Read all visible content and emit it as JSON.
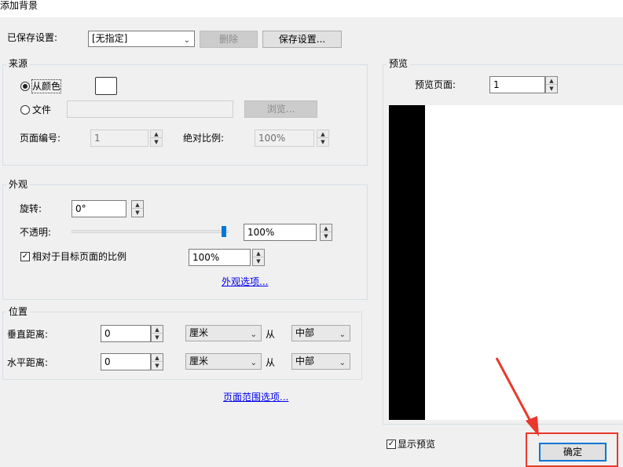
{
  "window": {
    "title": "添加背景"
  },
  "saved": {
    "label": "已保存设置:",
    "selected": "[无指定]",
    "delete_label": "删除",
    "save_label": "保存设置..."
  },
  "source": {
    "title": "来源",
    "from_color_label": "从颜色",
    "file_label": "文件",
    "browse_label": "浏览...",
    "page_number_label": "页面编号:",
    "page_number_value": "1",
    "absolute_scale_label": "绝对比例:",
    "absolute_scale_value": "100%",
    "color_swatch": "#ffffff"
  },
  "appearance": {
    "title": "外观",
    "rotation_label": "旋转:",
    "rotation_value": "0°",
    "opacity_label": "不透明:",
    "opacity_value": "100%",
    "opacity_level": 1.0,
    "relative_scale_label": "相对于目标页面的比例",
    "relative_scale_checked": true,
    "relative_scale_value": "100%",
    "options_link": "外观选项..."
  },
  "position": {
    "title": "位置",
    "vertical_label": "垂直距离:",
    "vertical_value": "0",
    "vertical_unit": "厘米",
    "vertical_from": "从",
    "vertical_anchor": "中部",
    "horizontal_label": "水平距离:",
    "horizontal_value": "0",
    "horizontal_unit": "厘米",
    "horizontal_from": "从",
    "horizontal_anchor": "中部"
  },
  "page_range_link": "页面范围选项...",
  "preview": {
    "title": "预览",
    "page_label": "预览页面:",
    "page_value": "1",
    "show_preview_label": "显示预览",
    "show_preview_checked": true
  },
  "ok_label": "确定",
  "colors": {
    "highlight_red": "#e8392d",
    "link_blue": "#0000ee",
    "accent_blue": "#0078d7"
  }
}
